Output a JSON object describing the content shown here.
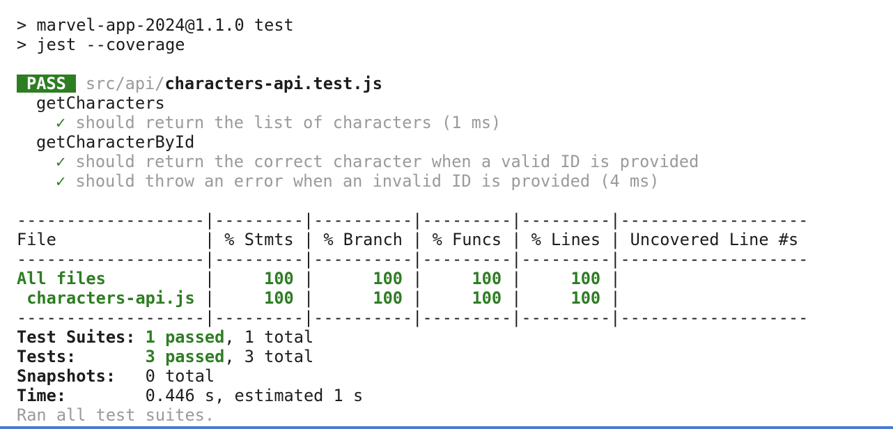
{
  "command": {
    "line1": "> marvel-app-2024@1.1.0 test",
    "line2": "> jest --coverage"
  },
  "result": {
    "badge": "PASS",
    "path_dir": "src/api/",
    "path_file": "characters-api.test.js"
  },
  "suites": [
    {
      "name": "getCharacters",
      "tests": [
        {
          "mark": "✓",
          "text": "should return the list of characters (1 ms)"
        }
      ]
    },
    {
      "name": "getCharacterById",
      "tests": [
        {
          "mark": "✓",
          "text": "should return the correct character when a valid ID is provided"
        },
        {
          "mark": "✓",
          "text": "should throw an error when an invalid ID is provided (4 ms)"
        }
      ]
    }
  ],
  "coverage": {
    "separator": "-------------------|---------|----------|---------|---------|-------------------",
    "header_row": "File               | % Stmts | % Branch | % Funcs | % Lines | Uncovered Line #s ",
    "rows": [
      {
        "file": "All files         ",
        "stmts": "100",
        "branch": "100",
        "funcs": "100",
        "lines": "100",
        "uncovered": ""
      },
      {
        "file": " characters-api.js",
        "stmts": "100",
        "branch": "100",
        "funcs": "100",
        "lines": "100",
        "uncovered": ""
      }
    ]
  },
  "summary": {
    "suites_label": "Test Suites: ",
    "suites_passed": "1 passed",
    "suites_total": ", 1 total",
    "tests_label": "Tests:       ",
    "tests_passed": "3 passed",
    "tests_total": ", 3 total",
    "snapshots_label": "Snapshots:   ",
    "snapshots_value": "0 total",
    "time_label": "Time:        ",
    "time_value": "0.446 s, estimated 1 s",
    "footer": "Ran all test suites."
  },
  "colors": {
    "pass_green": "#2e7d23",
    "dim_gray": "#9a9a9a",
    "bottom_bar": "#4a7bd0"
  }
}
